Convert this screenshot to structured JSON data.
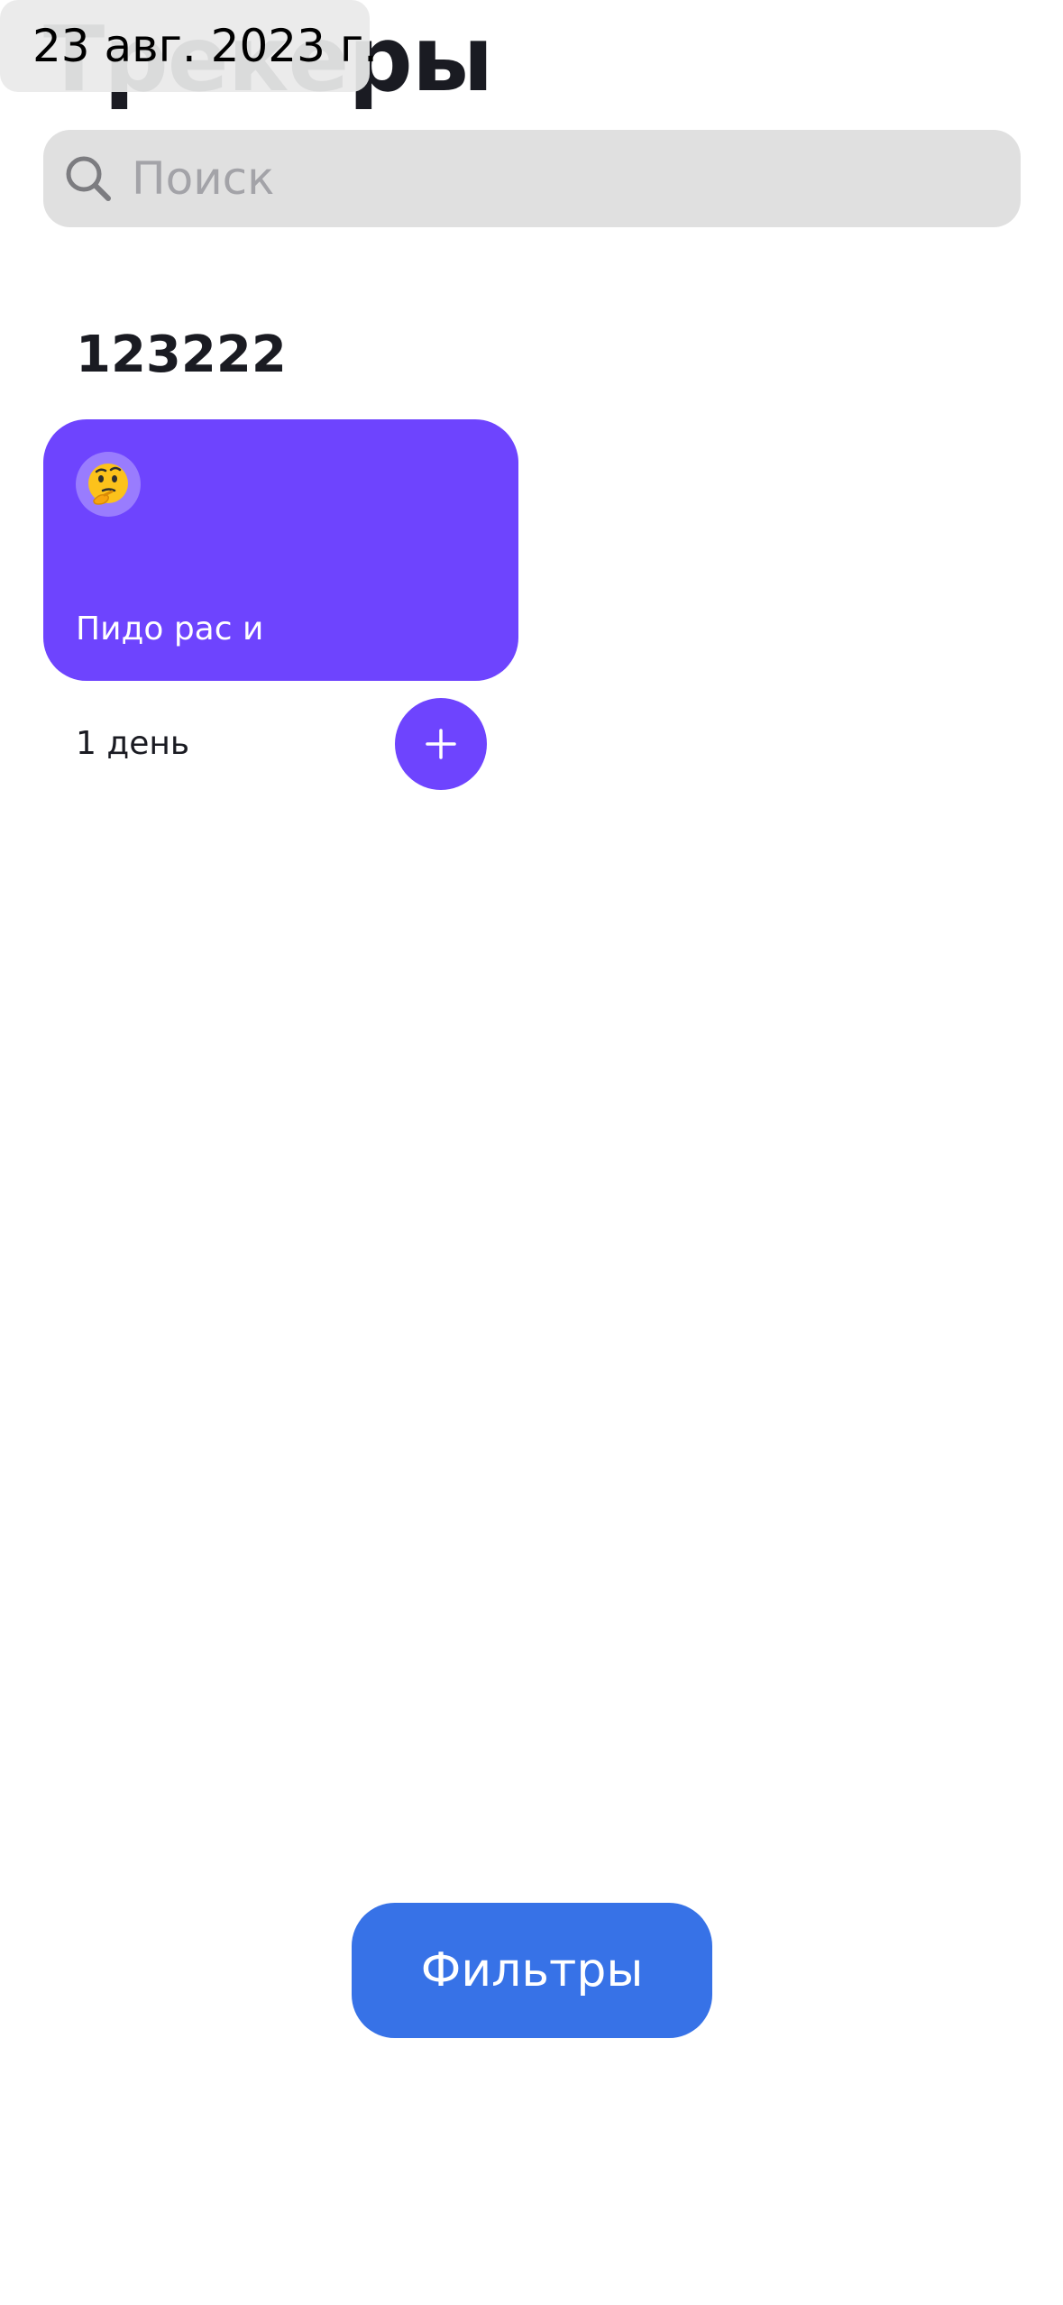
{
  "header": {
    "title": "Трекеры",
    "date": "23 авг. 2023 г."
  },
  "search": {
    "placeholder": "Поиск",
    "value": ""
  },
  "categories": [
    {
      "title": "123222",
      "trackers": [
        {
          "name": "Пидо рас и",
          "emoji": "thinking-face",
          "days": "1 день",
          "color": "#6e44fe"
        }
      ]
    }
  ],
  "filters": {
    "label": "Фильтры",
    "color": "#3772e7"
  }
}
